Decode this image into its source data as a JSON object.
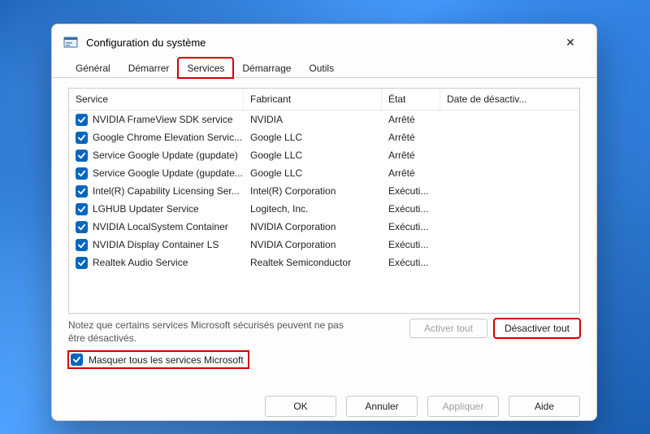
{
  "window": {
    "title": "Configuration du système"
  },
  "tabs": {
    "general": "Général",
    "demarrer": "Démarrer",
    "services": "Services",
    "demarrage": "Démarrage",
    "outils": "Outils"
  },
  "columns": {
    "service": "Service",
    "fabricant": "Fabricant",
    "etat": "État",
    "date": "Date de désactiv..."
  },
  "rows": [
    {
      "service": "NVIDIA FrameView SDK service",
      "fab": "NVIDIA",
      "etat": "Arrêté",
      "date": ""
    },
    {
      "service": "Google Chrome Elevation Servic...",
      "fab": "Google LLC",
      "etat": "Arrêté",
      "date": ""
    },
    {
      "service": "Service Google Update (gupdate)",
      "fab": "Google LLC",
      "etat": "Arrêté",
      "date": ""
    },
    {
      "service": "Service Google Update (gupdate...",
      "fab": "Google LLC",
      "etat": "Arrêté",
      "date": ""
    },
    {
      "service": "Intel(R) Capability Licensing Ser...",
      "fab": "Intel(R) Corporation",
      "etat": "Exécuti...",
      "date": ""
    },
    {
      "service": "LGHUB Updater Service",
      "fab": "Logitech, Inc.",
      "etat": "Exécuti...",
      "date": ""
    },
    {
      "service": "NVIDIA LocalSystem Container",
      "fab": "NVIDIA Corporation",
      "etat": "Exécuti...",
      "date": ""
    },
    {
      "service": "NVIDIA Display Container LS",
      "fab": "NVIDIA Corporation",
      "etat": "Exécuti...",
      "date": ""
    },
    {
      "service": "Realtek Audio Service",
      "fab": "Realtek Semiconductor",
      "etat": "Exécuti...",
      "date": ""
    }
  ],
  "note": "Notez que certains services Microsoft sécurisés peuvent ne pas être désactivés.",
  "buttons": {
    "activer_tout": "Activer tout",
    "desactiver_tout": "Désactiver tout",
    "ok": "OK",
    "annuler": "Annuler",
    "appliquer": "Appliquer",
    "aide": "Aide"
  },
  "hide_ms": "Masquer tous les services Microsoft"
}
